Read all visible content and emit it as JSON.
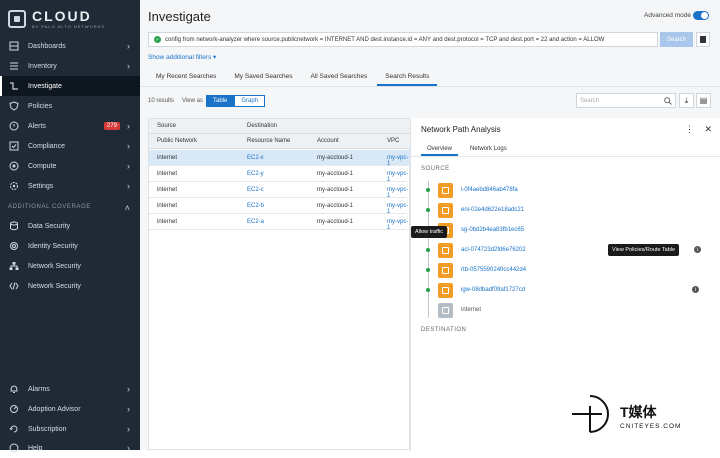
{
  "sidebar": {
    "logo": "CLOUD",
    "logo_sub": "BY PALO ALTO NETWORKS",
    "items": [
      {
        "label": "Dashboards"
      },
      {
        "label": "Inventory"
      },
      {
        "label": "Investigate"
      },
      {
        "label": "Policies"
      },
      {
        "label": "Alerts",
        "badge": "279"
      },
      {
        "label": "Compliance"
      },
      {
        "label": "Compute"
      },
      {
        "label": "Settings"
      }
    ],
    "section": "ADDITIONAL COVERAGE",
    "extra": [
      {
        "label": "Data Security"
      },
      {
        "label": "Identity Security"
      },
      {
        "label": "Network Security"
      },
      {
        "label": "Network Security"
      }
    ],
    "bottom": [
      {
        "label": "Alarms"
      },
      {
        "label": "Adoption Advisor"
      },
      {
        "label": "Subscription"
      },
      {
        "label": "Help"
      }
    ]
  },
  "header": {
    "title": "Investigate",
    "advanced_mode": "Advanced mode"
  },
  "query": {
    "text": "config from network-analyzer where source.publicnetwork = INTERNET AND dest.instance.id = ANY and dest.protocol = TCP and dest.port = 22 and action = ALLOW",
    "search_label": "Search",
    "filters_label": "Show additional filters"
  },
  "tabs": [
    "My Recent Searches",
    "My Saved Searches",
    "All Saved Searches",
    "Search Results"
  ],
  "results": {
    "count": "10 results",
    "view_as": "View as",
    "table": "Table",
    "graph": "Graph",
    "search_placeholder": "Search"
  },
  "grid": {
    "group_source": "Source",
    "group_dest": "Destination",
    "columns": [
      "Public Network",
      "Resource Name",
      "Account",
      "VPC"
    ],
    "rows": [
      [
        "internet",
        "EC2-x",
        "my-accloud-1",
        "my-vpc-1"
      ],
      [
        "internet",
        "EC2-y",
        "my-accloud-1",
        "my-vpc-1"
      ],
      [
        "internet",
        "EC2-c",
        "my-accloud-1",
        "my-vpc-1"
      ],
      [
        "internet",
        "EC2-b",
        "my-accloud-1",
        "my-vpc-1"
      ],
      [
        "internet",
        "EC2-a",
        "my-accloud-1",
        "my-vpc-1"
      ]
    ]
  },
  "panel": {
    "title": "Network Path Analysis",
    "tabs": [
      "Overview",
      "Network Logs"
    ],
    "source_label": "SOURCE",
    "dest_label": "DESTINATION",
    "nodes": [
      "i-0f4aebd846ab478fa",
      "eni-02e4d622e18adc21",
      "sg-0bd2b4ea83fb1ec65",
      "acl-074723d2fd6e76202",
      "rtb-0575590240cc442d4",
      "igw-08dbadf09af1727cd",
      "internet"
    ],
    "tooltip_allow": "Allow traffic",
    "tooltip_view": "View Policies/Route Table"
  },
  "watermark": {
    "title": "T媒体",
    "subtitle": "CNITEYES.COM"
  }
}
